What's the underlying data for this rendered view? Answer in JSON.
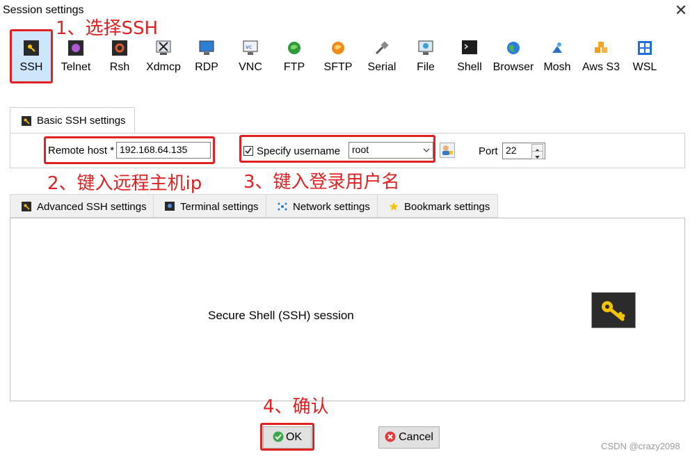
{
  "window": {
    "title": "Session settings",
    "close": "✕"
  },
  "toolbar": {
    "items": [
      {
        "label": "SSH",
        "icon": "ssh-key-icon"
      },
      {
        "label": "Telnet",
        "icon": "telnet-icon"
      },
      {
        "label": "Rsh",
        "icon": "rsh-icon"
      },
      {
        "label": "Xdmcp",
        "icon": "xdmcp-icon"
      },
      {
        "label": "RDP",
        "icon": "rdp-icon"
      },
      {
        "label": "VNC",
        "icon": "vnc-icon"
      },
      {
        "label": "FTP",
        "icon": "ftp-icon"
      },
      {
        "label": "SFTP",
        "icon": "sftp-icon"
      },
      {
        "label": "Serial",
        "icon": "serial-icon"
      },
      {
        "label": "File",
        "icon": "file-icon"
      },
      {
        "label": "Shell",
        "icon": "shell-icon"
      },
      {
        "label": "Browser",
        "icon": "browser-icon"
      },
      {
        "label": "Mosh",
        "icon": "mosh-icon"
      },
      {
        "label": "Aws S3",
        "icon": "aws-s3-icon"
      },
      {
        "label": "WSL",
        "icon": "wsl-icon"
      }
    ],
    "selected": "SSH"
  },
  "annotations": {
    "step1": "1、选择SSH",
    "step2": "2、键入远程主机ip",
    "step3": "3、键入登录用户名",
    "step4": "4、确认"
  },
  "basic": {
    "tab_label": "Basic SSH settings",
    "remote_host_label": "Remote host *",
    "remote_host_value": "192.168.64.135",
    "specify_username_label": "Specify username",
    "specify_username_checked": true,
    "username_value": "root",
    "port_label": "Port",
    "port_value": "22"
  },
  "tabs": [
    {
      "label": "Advanced SSH settings",
      "icon": "ssh-key-icon"
    },
    {
      "label": "Terminal settings",
      "icon": "terminal-icon"
    },
    {
      "label": "Network settings",
      "icon": "network-icon"
    },
    {
      "label": "Bookmark settings",
      "icon": "star-icon"
    }
  ],
  "main": {
    "description": "Secure Shell (SSH) session"
  },
  "buttons": {
    "ok": "OK",
    "cancel": "Cancel"
  },
  "watermark": "CSDN @crazy2098",
  "colors": {
    "annotation_red": "#e02020",
    "selected_bg": "#cde6fb"
  }
}
